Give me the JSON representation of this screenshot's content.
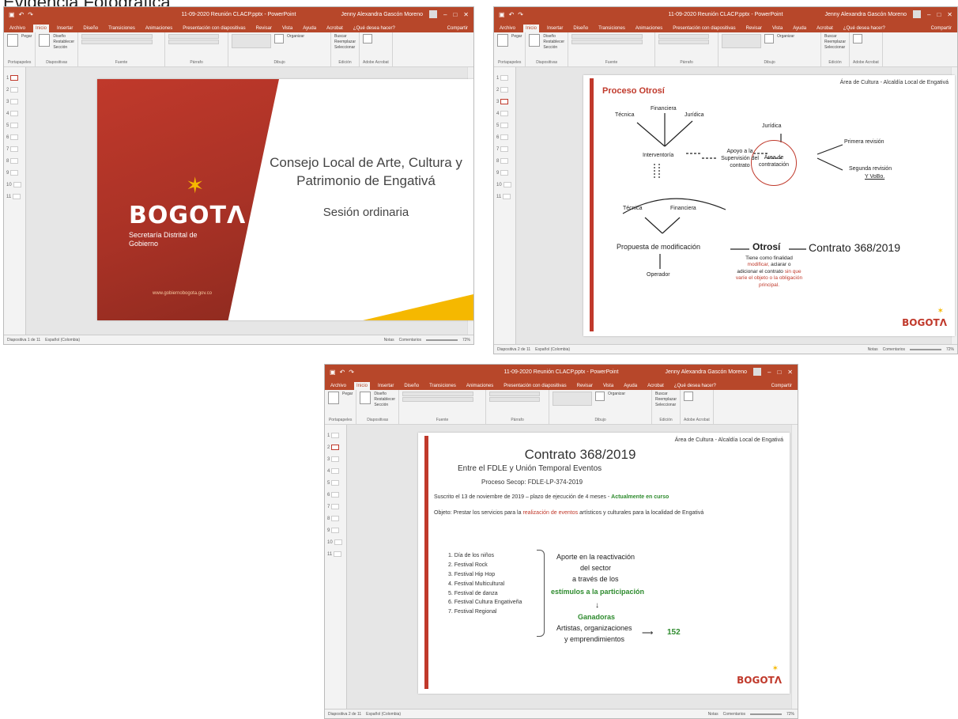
{
  "page_heading": "Evidencia Fotográfica",
  "app": {
    "file_title_1": "11-09-2020 Reunión CLACP.pptx - PowerPoint",
    "file_title_2": "11-09-2020 Reunión CLACP.pptx - PowerPoint",
    "file_title_3": "11-09-2020 Reunión CLACP.pptx - PowerPoint",
    "user": "Jenny Alexandra Gascón Moreno",
    "tabs": [
      "Archivo",
      "Inicio",
      "Insertar",
      "Diseño",
      "Transiciones",
      "Animaciones",
      "Presentación con diapositivas",
      "Revisar",
      "Vista",
      "Ayuda",
      "Acrobat",
      "¿Qué desea hacer?"
    ],
    "share": "Compartir",
    "ribbon_groups": [
      "Portapapeles",
      "Diapositivas",
      "Fuente",
      "Párrafo",
      "Dibujo",
      "Edición",
      "Adobe Acrobat"
    ],
    "ribbon_buttons": {
      "paste": "Pegar",
      "new_slide": "Nueva diapositiva",
      "layout": "Diseño",
      "reset": "Restablecer",
      "section": "Sección",
      "arrange": "Organizar",
      "find": "Buscar",
      "replace": "Reemplazar",
      "select": "Seleccionar",
      "create_pdf": "Crear y compartir PDF de Adobe"
    },
    "thumb_numbers": [
      "1",
      "2",
      "3",
      "4",
      "5",
      "6",
      "7",
      "8",
      "9",
      "10",
      "11"
    ]
  },
  "statusbars": [
    {
      "slide": "Diapositiva 1 de 11",
      "lang": "Español (Colombia)",
      "notes": "Notas",
      "comments": "Comentarios",
      "zoom": "72%"
    },
    {
      "slide": "Diapositiva 2 de 11",
      "lang": "Español (Colombia)",
      "notes": "Notas",
      "comments": "Comentarios",
      "zoom": "72%"
    },
    {
      "slide": "Diapositiva 2 de 11",
      "lang": "Español (Colombia)",
      "notes": "Notas",
      "comments": "Comentarios",
      "zoom": "72%"
    }
  ],
  "slide1": {
    "title": "Consejo Local de Arte, Cultura y Patrimonio de Engativá",
    "subtitle": "Sesión ordinaria",
    "logo": "BOGOTΛ",
    "logo_sub": "Secretaría Distrital de Gobierno",
    "url": "www.gobiernobogota.gov.co"
  },
  "slide2": {
    "header": "Área de Cultura - Alcaldía Local de Engativá",
    "title": "Proceso Otrosí",
    "tecnica": "Técnica",
    "financiera": "Financiera",
    "juridica": "Jurídica",
    "interventoria": "Interventoría",
    "apoyo": "Apoyo a la Supervisión del contrato",
    "area": "Área de contratación",
    "juridica2": "Jurídica",
    "primera": "Primera revisión",
    "segunda": "Segunda revisión",
    "vobo": "Y VoBo.",
    "tecnica2": "Técnica",
    "financiera2": "Financiera",
    "propuesta": "Propuesta de modificación",
    "operador": "Operador",
    "otrosi": "Otrosí",
    "contrato": "Contrato 368/2019",
    "finalidad_a": "Tiene como finalidad",
    "finalidad_b": "modificar,",
    "finalidad_c": "aclarar o",
    "finalidad_d": "adicionar el contrato",
    "finalidad_e": "sin que varíe el objeto o la obligación principal.",
    "logo": "BOGOTΛ"
  },
  "slide3": {
    "header": "Área de Cultura - Alcaldía Local de Engativá",
    "title": "Contrato 368/2019",
    "sub1": "Entre el FDLE y Unión Temporal Eventos",
    "sub2": "Proceso Secop: FDLE-LP-374-2019",
    "suscrito": "Suscrito el 13 de noviembre de 2019 – plazo de ejecución de 4 meses -",
    "actual": "Actualmente en curso",
    "objeto_a": "Objeto: Prestar los servicios para la",
    "objeto_b": "realización de eventos",
    "objeto_c": "artísticos y culturales para la localidad de Engativá",
    "list": [
      "1. Día de los niños",
      "2. Festival Rock",
      "3. Festival Hip Hop",
      "4. Festival Multicultural",
      "5. Festival de danza",
      "6. Festival Cultura Engativeña",
      "7. Festival Regional"
    ],
    "aporte1": "Aporte en la reactivación",
    "aporte2": "del sector",
    "aporte3": "a través de los",
    "estimulos": "estímulos a la participación",
    "ganadoras": "Ganadoras",
    "artistas1": "Artistas, organizaciones",
    "artistas2": "y emprendimientos",
    "count": "152",
    "logo": "BOGOTΛ"
  }
}
